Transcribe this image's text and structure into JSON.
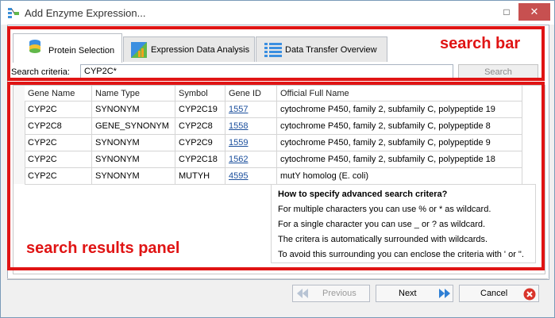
{
  "window": {
    "title": "Add Enzyme Expression..."
  },
  "titlebar": {
    "maximize_glyph": "□",
    "close_glyph": "✕"
  },
  "tabs": [
    {
      "label": "Protein Selection",
      "icon": "protein-stack-icon",
      "active": true
    },
    {
      "label": "Expression Data Analysis",
      "icon": "chart-icon",
      "active": false
    },
    {
      "label": "Data Transfer Overview",
      "icon": "list-icon",
      "active": false
    }
  ],
  "search": {
    "label": "Search criteria:",
    "value": "CYP2C*",
    "button_label": "Search"
  },
  "table": {
    "columns": [
      "Gene Name",
      "Name Type",
      "Symbol",
      "Gene ID",
      "Official Full Name"
    ],
    "rows": [
      [
        "CYP2C",
        "SYNONYM",
        "CYP2C19",
        "1557",
        "cytochrome P450, family 2, subfamily C, polypeptide 19"
      ],
      [
        "CYP2C8",
        "GENE_SYNONYM",
        "CYP2C8",
        "1558",
        "cytochrome P450, family 2, subfamily C, polypeptide 8"
      ],
      [
        "CYP2C",
        "SYNONYM",
        "CYP2C9",
        "1559",
        "cytochrome P450, family 2, subfamily C, polypeptide 9"
      ],
      [
        "CYP2C",
        "SYNONYM",
        "CYP2C18",
        "1562",
        "cytochrome P450, family 2, subfamily C, polypeptide 18"
      ],
      [
        "CYP2C",
        "SYNONYM",
        "MUTYH",
        "4595",
        "mutY homolog (E. coli)"
      ]
    ]
  },
  "help": {
    "title": "How to specify advanced search critera?",
    "lines": [
      "For multiple characters you can use % or * as wildcard.",
      "For a single character you can use _ or ? as wildcard.",
      "The critera is automatically surrounded with wildcards.",
      "To avoid this surrounding you can enclose the criteria with ' or \"."
    ]
  },
  "annotations": {
    "search_bar": "search bar",
    "results_panel": "search results panel",
    "color": "#e01414"
  },
  "footer": {
    "previous_label": "Previous",
    "next_label": "Next",
    "cancel_label": "Cancel"
  }
}
